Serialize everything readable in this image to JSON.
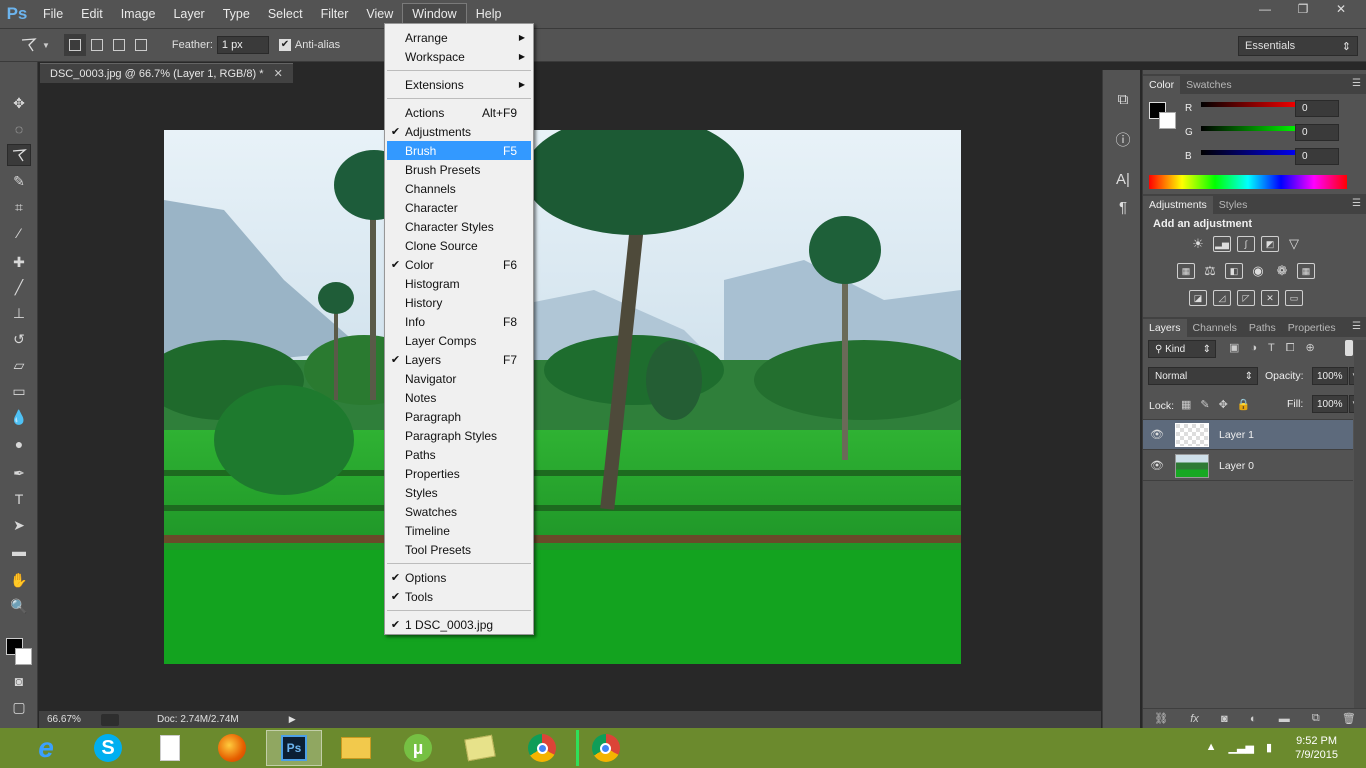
{
  "app": {
    "logo": "Ps",
    "menus": [
      "File",
      "Edit",
      "Image",
      "Layer",
      "Type",
      "Select",
      "Filter",
      "View",
      "Window",
      "Help"
    ],
    "active_menu": "Window",
    "window_controls": [
      "—",
      "❐",
      "✕"
    ]
  },
  "options": {
    "feather_label": "Feather:",
    "feather_value": "1 px",
    "antialias_label": "Anti-alias",
    "workspace": "Essentials"
  },
  "document": {
    "tab_title": "DSC_0003.jpg @ 66.7% (Layer 1, RGB/8) *",
    "zoom": "66.67%",
    "doc_size": "Doc: 2.74M/2.74M"
  },
  "window_menu": {
    "items": [
      {
        "label": "Arrange",
        "submenu": true
      },
      {
        "label": "Workspace",
        "submenu": true
      },
      {
        "sep": true
      },
      {
        "label": "Extensions",
        "submenu": true
      },
      {
        "sep": true
      },
      {
        "label": "Actions",
        "shortcut": "Alt+F9"
      },
      {
        "label": "Adjustments",
        "checked": true
      },
      {
        "label": "Brush",
        "shortcut": "F5",
        "highlighted": true
      },
      {
        "label": "Brush Presets"
      },
      {
        "label": "Channels"
      },
      {
        "label": "Character"
      },
      {
        "label": "Character Styles"
      },
      {
        "label": "Clone Source"
      },
      {
        "label": "Color",
        "shortcut": "F6",
        "checked": true
      },
      {
        "label": "Histogram"
      },
      {
        "label": "History"
      },
      {
        "label": "Info",
        "shortcut": "F8"
      },
      {
        "label": "Layer Comps"
      },
      {
        "label": "Layers",
        "shortcut": "F7",
        "checked": true
      },
      {
        "label": "Navigator"
      },
      {
        "label": "Notes"
      },
      {
        "label": "Paragraph"
      },
      {
        "label": "Paragraph Styles"
      },
      {
        "label": "Paths"
      },
      {
        "label": "Properties"
      },
      {
        "label": "Styles"
      },
      {
        "label": "Swatches"
      },
      {
        "label": "Timeline"
      },
      {
        "label": "Tool Presets"
      },
      {
        "sep": true
      },
      {
        "label": "Options",
        "checked": true
      },
      {
        "label": "Tools",
        "checked": true
      },
      {
        "sep": true
      },
      {
        "label": "1 DSC_0003.jpg",
        "checked": true
      }
    ]
  },
  "color_panel": {
    "tabs": [
      "Color",
      "Swatches"
    ],
    "channels": [
      {
        "label": "R",
        "value": "0"
      },
      {
        "label": "G",
        "value": "0"
      },
      {
        "label": "B",
        "value": "0"
      }
    ]
  },
  "adjustments_panel": {
    "tabs": [
      "Adjustments",
      "Styles"
    ],
    "title": "Add an adjustment"
  },
  "layers_panel": {
    "tabs": [
      "Layers",
      "Channels",
      "Paths",
      "Properties"
    ],
    "filter": "Kind",
    "blend_mode": "Normal",
    "opacity_label": "Opacity:",
    "opacity": "100%",
    "lock_label": "Lock:",
    "fill_label": "Fill:",
    "fill": "100%",
    "layers": [
      {
        "name": "Layer 1",
        "selected": true
      },
      {
        "name": "Layer 0",
        "selected": false
      }
    ],
    "footer_icons": [
      "link-icon",
      "fx-icon",
      "mask-icon",
      "adjustment-icon",
      "folder-icon",
      "new-layer-icon",
      "trash-icon"
    ]
  },
  "taskbar": {
    "apps": [
      "internet-explorer",
      "skype",
      "notepad",
      "firefox",
      "photoshop",
      "file-explorer",
      "utorrent",
      "briefcase",
      "chrome",
      "chrome"
    ],
    "time": "9:52 PM",
    "date": "7/9/2015"
  },
  "colors": {
    "ui_dark": "#535353",
    "canvas_bg": "#282828",
    "menu_highlight": "#3399ff",
    "taskbar": "#6b8a2d",
    "layer_selected": "#5d6a7c"
  }
}
